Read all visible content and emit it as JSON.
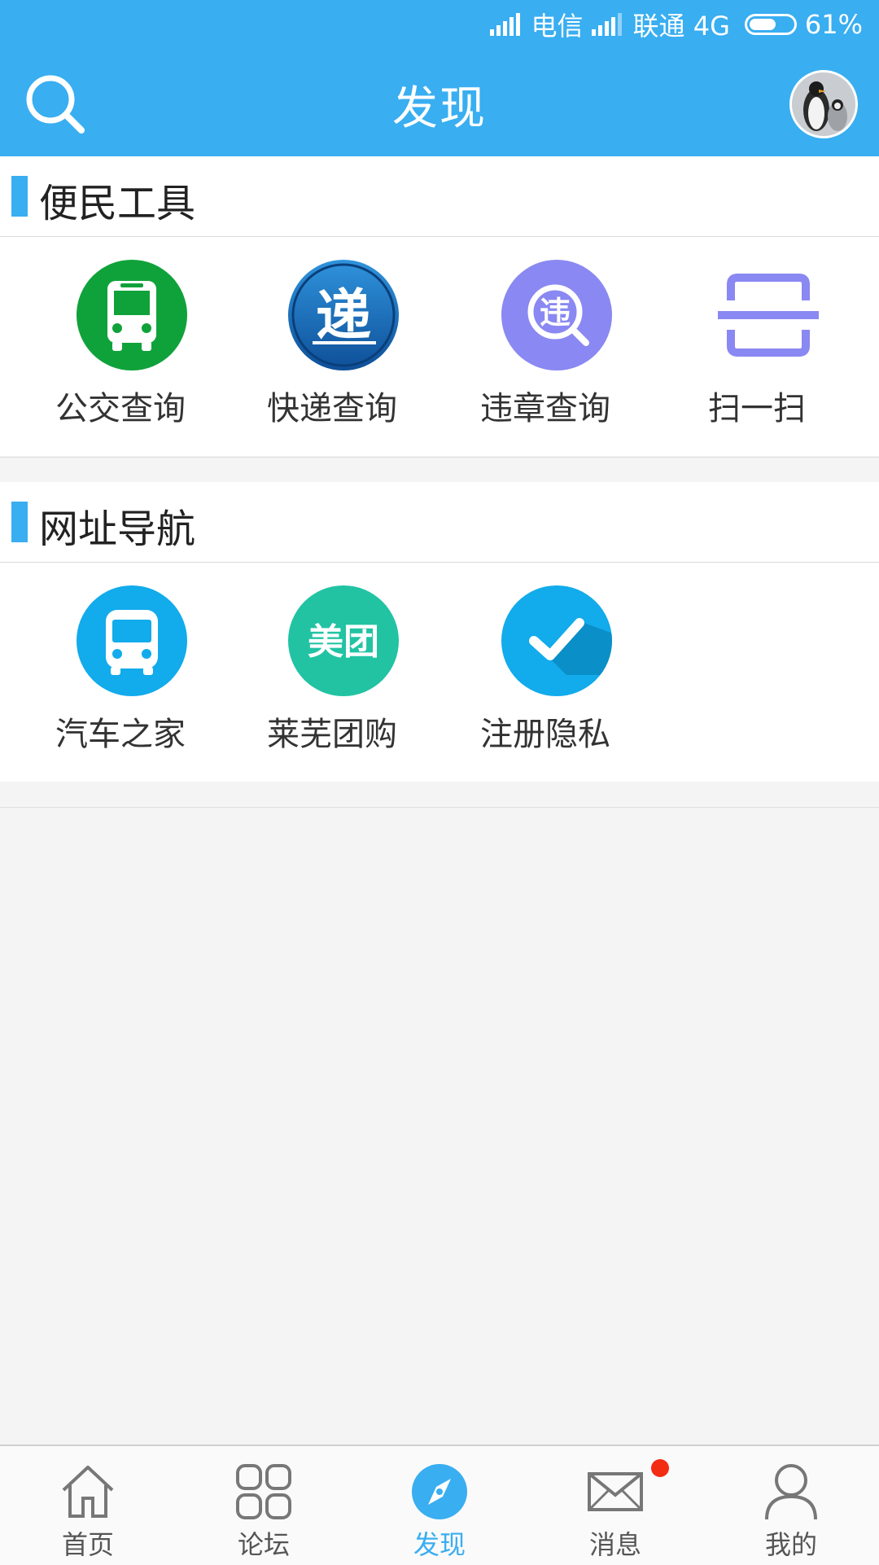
{
  "status_bar": {
    "carrier1": "电信",
    "carrier2": "联通 4G",
    "battery": "61%",
    "battery_level": 0.61
  },
  "header": {
    "title": "发现",
    "search_icon": "search-icon",
    "avatar_icon": "penguin-avatar"
  },
  "sections": [
    {
      "title": "便民工具",
      "items": [
        {
          "label": "公交查询",
          "icon": "bus-icon",
          "color": "#10a23a"
        },
        {
          "label": "快递查询",
          "icon": "express-icon",
          "color": "#1467b5"
        },
        {
          "label": "违章查询",
          "icon": "violation-icon",
          "color": "#8a88f2"
        },
        {
          "label": "扫一扫",
          "icon": "scan-icon",
          "color": "#8a88f2"
        }
      ]
    },
    {
      "title": "网址导航",
      "items": [
        {
          "label": "汽车之家",
          "icon": "car-home-icon",
          "color": "#12abeb"
        },
        {
          "label": "莱芜团购",
          "icon": "meituan-icon",
          "color": "#21c3a3",
          "icon_text": "美团"
        },
        {
          "label": "注册隐私",
          "icon": "check-icon",
          "color": "#12abeb"
        }
      ]
    }
  ],
  "icon_text": {
    "express": "递",
    "violation": "违"
  },
  "tabbar": {
    "tabs": [
      {
        "label": "首页",
        "icon": "home-icon",
        "active": false
      },
      {
        "label": "论坛",
        "icon": "forum-grid-icon",
        "active": false
      },
      {
        "label": "发现",
        "icon": "compass-icon",
        "active": true
      },
      {
        "label": "消息",
        "icon": "mail-icon",
        "active": false,
        "badge": true
      },
      {
        "label": "我的",
        "icon": "user-icon",
        "active": false
      }
    ]
  },
  "colors": {
    "primary": "#39aef1",
    "badge": "#f32c14",
    "background": "#f4f4f4"
  }
}
